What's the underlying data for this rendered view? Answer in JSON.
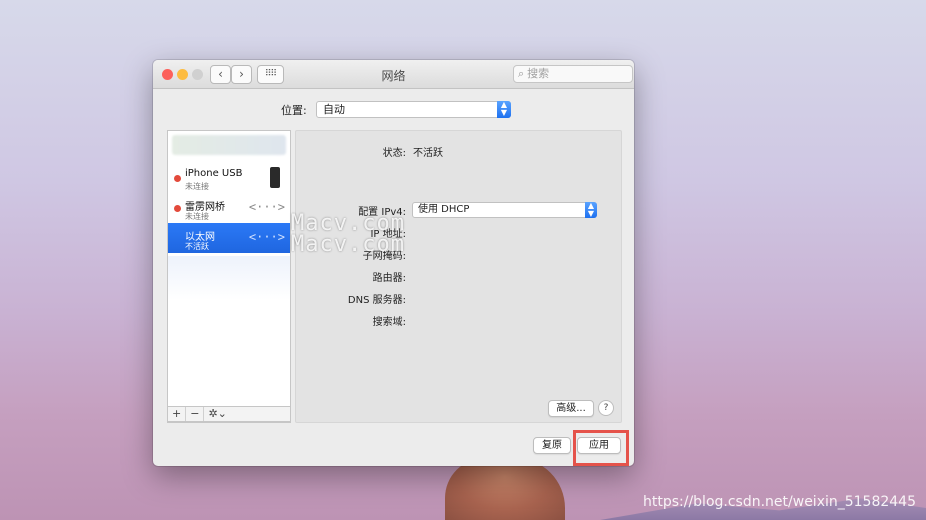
{
  "window": {
    "title": "网络"
  },
  "toolbar": {
    "back_glyph": "‹",
    "forward_glyph": "›",
    "grid_glyph": "⠿⠿",
    "search_placeholder": "搜索",
    "search_icon_glyph": "⌕"
  },
  "location": {
    "label": "位置:",
    "value": "自动"
  },
  "services": [
    {
      "name": "iPhone USB",
      "status": "未连接",
      "icon": "iphone-icon",
      "status_color": "#e34a3b"
    },
    {
      "name": "雷雳网桥",
      "status": "未连接",
      "icon": "connector-icon",
      "status_color": "#e34a3b"
    },
    {
      "name": "以太网",
      "status": "不活跃",
      "icon": "connector-icon",
      "selected": true
    }
  ],
  "list_toolbar": {
    "add": "+",
    "remove": "−",
    "gear": "✲⌄"
  },
  "detail": {
    "status_label": "状态:",
    "status_value": "不活跃",
    "ipv4_label": "配置 IPv4:",
    "ipv4_value": "使用 DHCP",
    "ip_label": "IP 地址:",
    "subnet_label": "子网掩码:",
    "router_label": "路由器:",
    "dns_label": "DNS 服务器:",
    "search_domain_label": "搜索域:",
    "advanced_button": "高级...",
    "help_button": "?"
  },
  "footer": {
    "revert_button": "复原",
    "apply_button": "应用"
  },
  "overlay": {
    "watermark_1": "Macv.com",
    "watermark_2": "Macv.com",
    "csdn": "https://blog.csdn.net/weixin_51582445"
  },
  "colors": {
    "accent": "#1f66e0",
    "highlight": "#e5534b"
  }
}
